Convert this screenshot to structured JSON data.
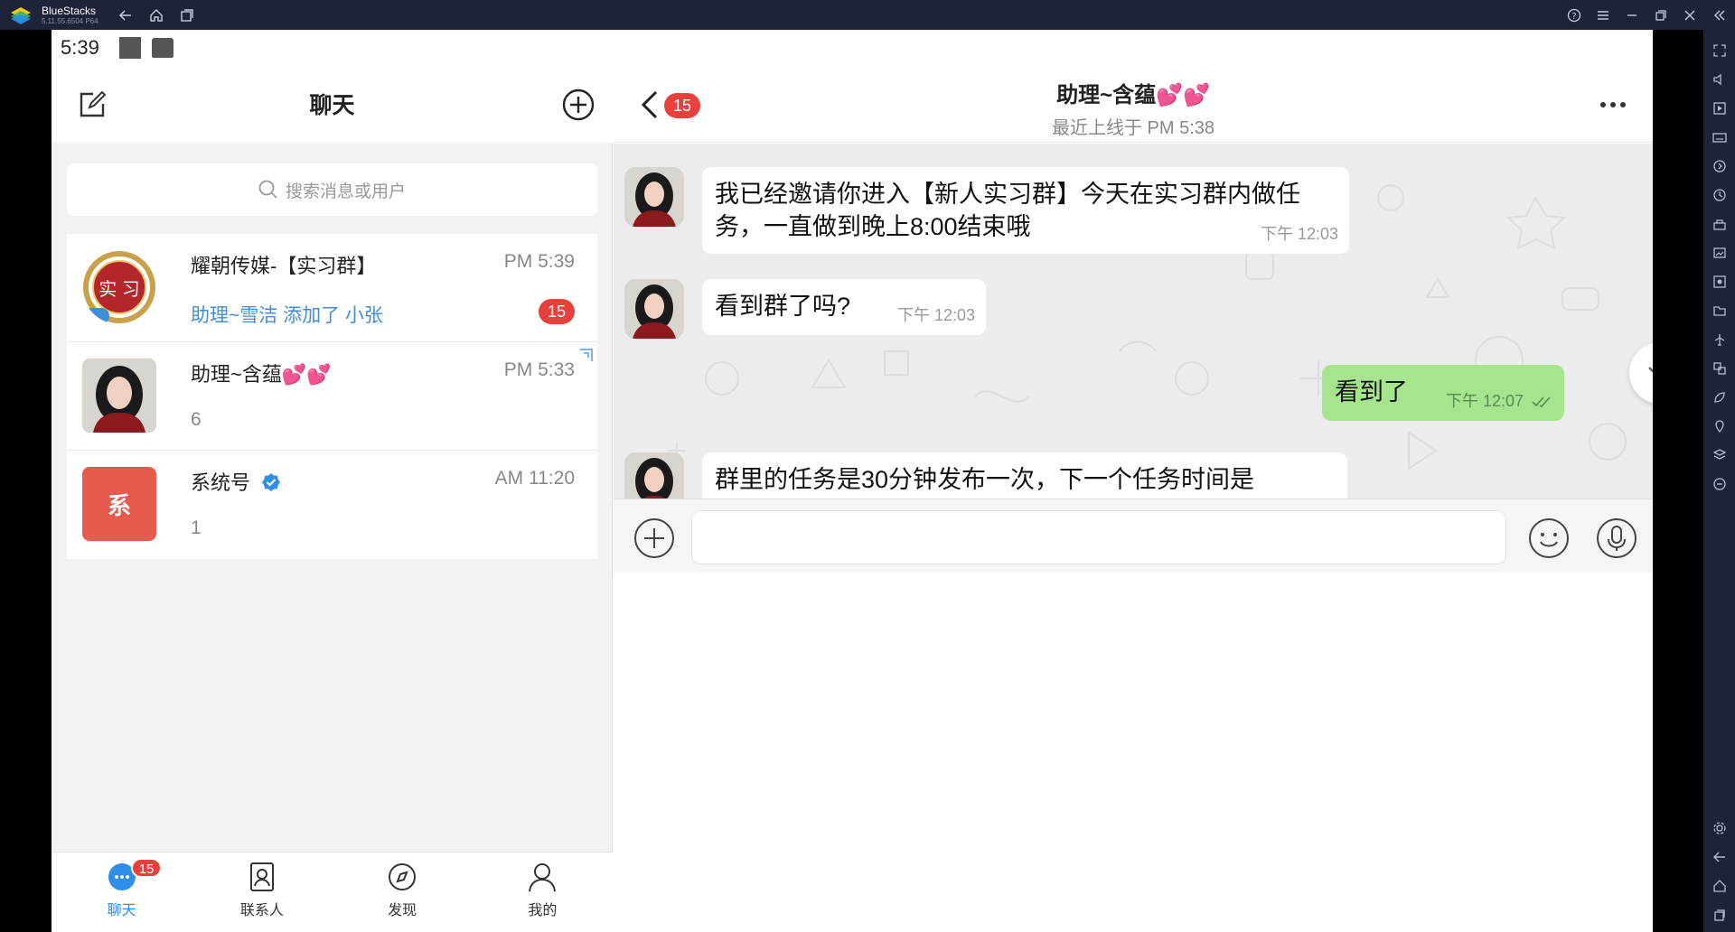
{
  "emulator": {
    "app_name": "BlueStacks",
    "version": "5.11.55.6504 P64"
  },
  "statusbar": {
    "time": "5:39"
  },
  "left": {
    "title": "聊天",
    "search_placeholder": "搜索消息或用户",
    "chats": [
      {
        "name": "耀朝传媒-【实习群】",
        "time": "PM 5:39",
        "preview": "助理~雪洁 添加了 小张",
        "badge": "15",
        "avatar_text": "实 习"
      },
      {
        "name": "助理~含蕴💕💕",
        "time": "PM 5:33",
        "preview": "6"
      },
      {
        "name": "系统号",
        "time": "AM 11:20",
        "preview": "1",
        "avatar_text": "系"
      }
    ],
    "nav": [
      {
        "label": "聊天",
        "badge": "15"
      },
      {
        "label": "联系人"
      },
      {
        "label": "发现"
      },
      {
        "label": "我的"
      }
    ]
  },
  "right": {
    "back_badge": "15",
    "title": "助理~含蕴💕💕",
    "subtitle": "最近上线于 PM 5:38",
    "messages": [
      {
        "text": "我已经邀请你进入【新人实习群】今天在实习群内做任务，一直做到晚上8:00结束哦",
        "time": "下午 12:03",
        "dir": "in"
      },
      {
        "text": "看到群了吗?",
        "time": "下午 12:03",
        "dir": "in"
      },
      {
        "text": "看到了",
        "time": "下午 12:07",
        "dir": "out"
      },
      {
        "text": "群里的任务是30分钟发布一次，下一个任务时间是",
        "dir": "in"
      }
    ]
  },
  "colors": {
    "accent_blue": "#2f8fe8",
    "badge_red": "#e8403c",
    "bubble_out": "#a6e58d",
    "system_avatar": "#e65b4d"
  }
}
